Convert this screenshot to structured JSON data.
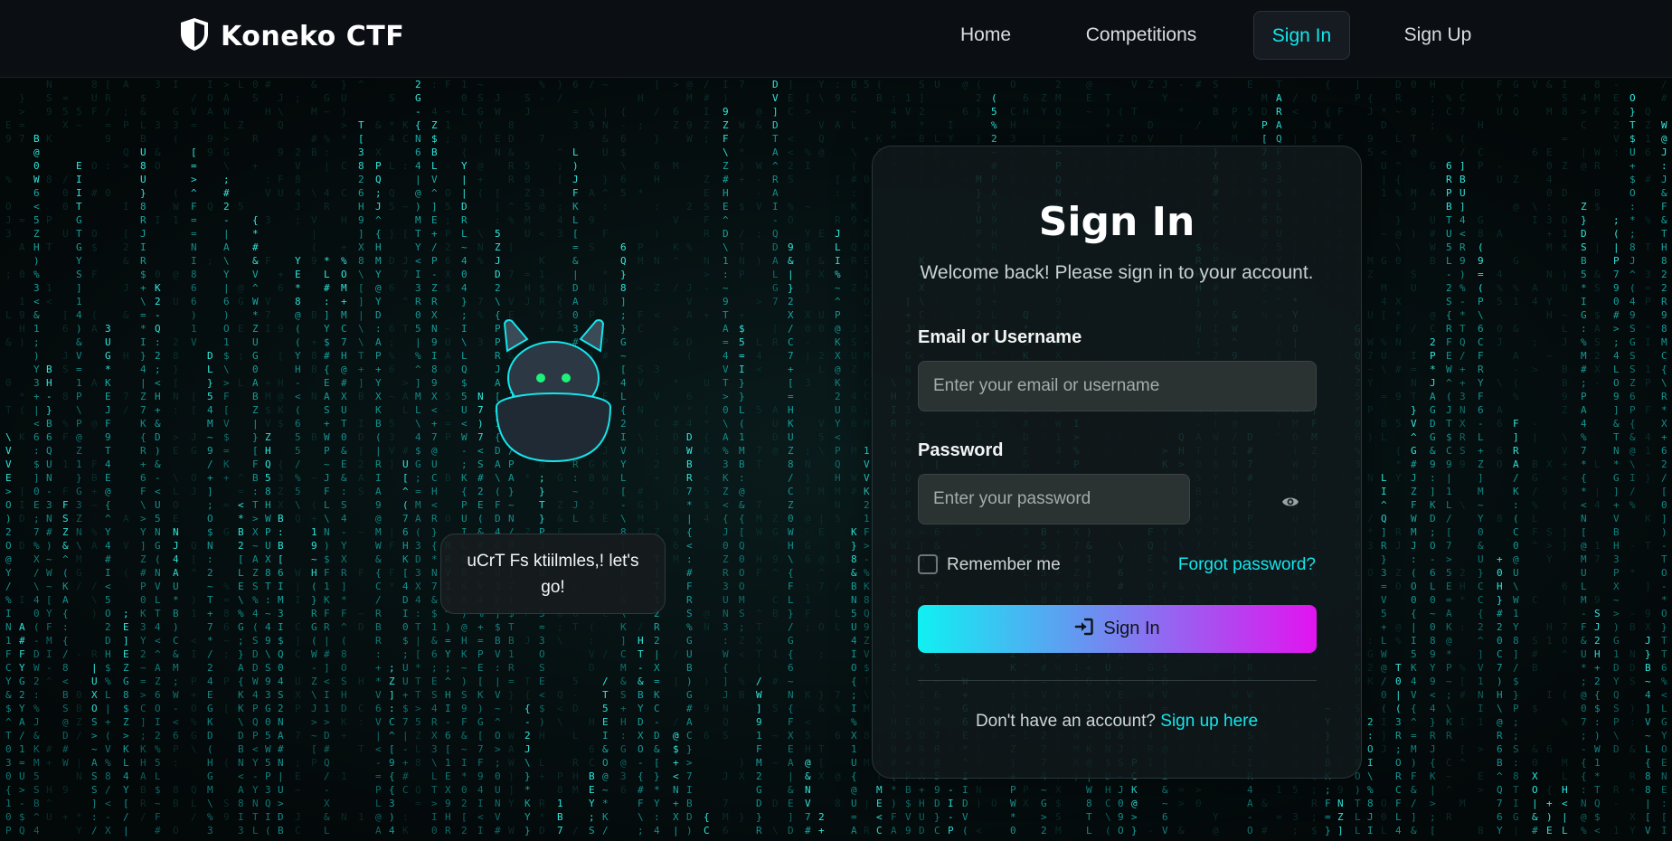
{
  "brand": {
    "name": "Koneko CTF",
    "icon": "shield-icon"
  },
  "nav": {
    "items": [
      {
        "label": "Home",
        "active": false
      },
      {
        "label": "Competitions",
        "active": false
      },
      {
        "label": "Sign In",
        "active": true
      },
      {
        "label": "Sign Up",
        "active": false
      }
    ]
  },
  "mascot": {
    "speech": "uCrT Fs ktiilmles,! let's go!"
  },
  "signin": {
    "title": "Sign In",
    "subtitle": "Welcome back! Please sign in to your account.",
    "email_label": "Email or Username",
    "email_placeholder": "Enter your email or username",
    "email_value": "",
    "password_label": "Password",
    "password_placeholder": "Enter your password",
    "password_value": "",
    "remember_label": "Remember me",
    "remember_checked": false,
    "forgot_label": "Forgot password?",
    "submit_label": "Sign In",
    "submit_icon": "sign-in-icon",
    "no_account_text": "Don't have an account?",
    "signup_link": "Sign up here"
  },
  "colors": {
    "accent": "#14e6ec",
    "gradient_start": "#10f0f2",
    "gradient_end": "#e214f0",
    "background": "#050b0c",
    "navbar": "#0b0e13"
  }
}
